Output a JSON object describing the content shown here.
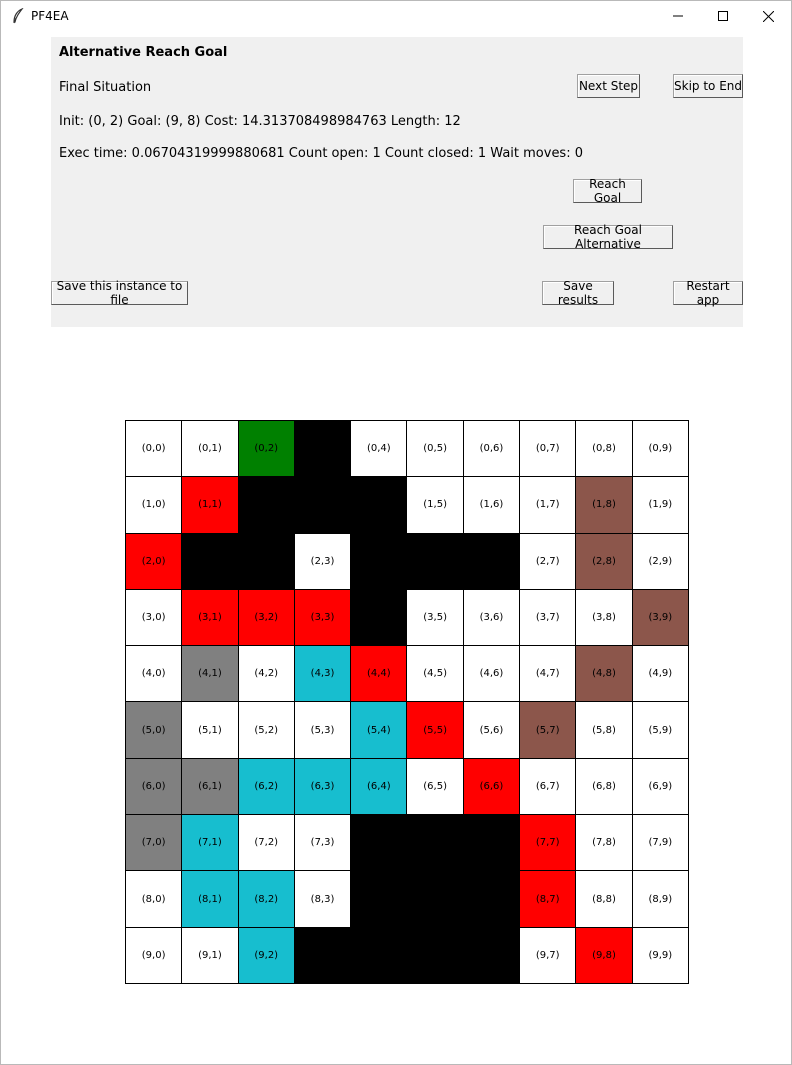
{
  "window": {
    "title": "PF4EA"
  },
  "header": {
    "heading": "Alternative Reach Goal",
    "situation": "Final Situation",
    "info_line": "Init: (0, 2)  Goal: (9, 8)  Cost: 14.313708498984763  Length: 12",
    "exec_line": "Exec time: 0.06704319999880681  Count open: 1  Count closed: 1  Wait moves: 0"
  },
  "buttons": {
    "next_step": "Next Step",
    "skip_to_end": "Skip to End",
    "reach_goal": "Reach Goal",
    "reach_goal_alternative": "Reach Goal Alternative",
    "save_instance": "Save this instance to file",
    "save_results": "Save results",
    "restart_app": "Restart app"
  },
  "colors": {
    "empty": "#ffffff",
    "obstacle": "#000000",
    "init": "#008000",
    "goal_path": "#ff0000",
    "agent_path": "#17becf",
    "other_agent": "#808080",
    "other_agent_2": "#8c564b",
    "panel_bg": "#f0f0f0"
  },
  "grid": {
    "rows": 10,
    "cols": 10,
    "cells": [
      [
        "empty",
        "empty",
        "init",
        "obstacle",
        "empty",
        "empty",
        "empty",
        "empty",
        "empty",
        "empty"
      ],
      [
        "empty",
        "goal_path",
        "obstacle",
        "obstacle",
        "obstacle",
        "empty",
        "empty",
        "empty",
        "other_agent_2",
        "empty"
      ],
      [
        "goal_path",
        "obstacle",
        "obstacle",
        "empty",
        "obstacle",
        "obstacle",
        "obstacle",
        "empty",
        "other_agent_2",
        "empty"
      ],
      [
        "empty",
        "goal_path",
        "goal_path",
        "goal_path",
        "obstacle",
        "empty",
        "empty",
        "empty",
        "empty",
        "other_agent_2"
      ],
      [
        "empty",
        "other_agent",
        "empty",
        "agent_path",
        "goal_path",
        "empty",
        "empty",
        "empty",
        "other_agent_2",
        "empty"
      ],
      [
        "other_agent",
        "empty",
        "empty",
        "empty",
        "agent_path",
        "goal_path",
        "empty",
        "other_agent_2",
        "empty",
        "empty"
      ],
      [
        "other_agent",
        "other_agent",
        "agent_path",
        "agent_path",
        "agent_path",
        "empty",
        "goal_path",
        "empty",
        "empty",
        "empty"
      ],
      [
        "other_agent",
        "agent_path",
        "empty",
        "empty",
        "obstacle",
        "obstacle",
        "obstacle",
        "goal_path",
        "empty",
        "empty"
      ],
      [
        "empty",
        "agent_path",
        "agent_path",
        "empty",
        "obstacle",
        "obstacle",
        "obstacle",
        "goal_path",
        "empty",
        "empty"
      ],
      [
        "empty",
        "empty",
        "agent_path",
        "obstacle",
        "obstacle",
        "obstacle",
        "obstacle",
        "empty",
        "goal_path",
        "empty"
      ]
    ],
    "labels": [
      [
        "(0,0)",
        "(0,1)",
        "(0,2)",
        "",
        "(0,4)",
        "(0,5)",
        "(0,6)",
        "(0,7)",
        "(0,8)",
        "(0,9)"
      ],
      [
        "(1,0)",
        "(1,1)",
        "",
        "",
        "",
        "(1,5)",
        "(1,6)",
        "(1,7)",
        "(1,8)",
        "(1,9)"
      ],
      [
        "(2,0)",
        "",
        "",
        "(2,3)",
        "",
        "",
        "",
        "(2,7)",
        "(2,8)",
        "(2,9)"
      ],
      [
        "(3,0)",
        "(3,1)",
        "(3,2)",
        "(3,3)",
        "",
        "(3,5)",
        "(3,6)",
        "(3,7)",
        "(3,8)",
        "(3,9)"
      ],
      [
        "(4,0)",
        "(4,1)",
        "(4,2)",
        "(4,3)",
        "(4,4)",
        "(4,5)",
        "(4,6)",
        "(4,7)",
        "(4,8)",
        "(4,9)"
      ],
      [
        "(5,0)",
        "(5,1)",
        "(5,2)",
        "(5,3)",
        "(5,4)",
        "(5,5)",
        "(5,6)",
        "(5,7)",
        "(5,8)",
        "(5,9)"
      ],
      [
        "(6,0)",
        "(6,1)",
        "(6,2)",
        "(6,3)",
        "(6,4)",
        "(6,5)",
        "(6,6)",
        "(6,7)",
        "(6,8)",
        "(6,9)"
      ],
      [
        "(7,0)",
        "(7,1)",
        "(7,2)",
        "(7,3)",
        "",
        "",
        "",
        "(7,7)",
        "(7,8)",
        "(7,9)"
      ],
      [
        "(8,0)",
        "(8,1)",
        "(8,2)",
        "(8,3)",
        "",
        "",
        "",
        "(8,7)",
        "(8,8)",
        "(8,9)"
      ],
      [
        "(9,0)",
        "(9,1)",
        "(9,2)",
        "",
        "",
        "",
        "",
        "(9,7)",
        "(9,8)",
        "(9,9)"
      ]
    ]
  }
}
